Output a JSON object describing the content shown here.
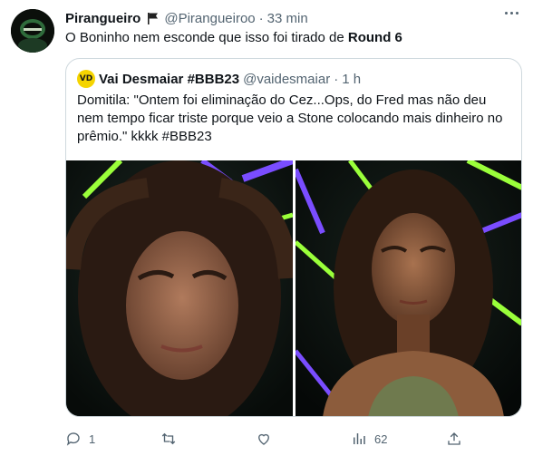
{
  "tweet": {
    "author_name": "Pirangueiro",
    "handle": "@Pirangueiroo",
    "separator": "·",
    "time": "33 min",
    "text_before": "O Boninho nem esconde que isso foi tirado de ",
    "text_bold": "Round 6",
    "icons": {
      "avatar": "squid-game-avatar",
      "flag": "flag-icon",
      "more": "more-icon"
    }
  },
  "quoted": {
    "author_name": "Vai Desmaiar #BBB23",
    "handle": "@vaidesmaiar",
    "separator": "·",
    "time": "1 h",
    "avatar_text": "VD",
    "text": "Domitila: \"Ontem foi eliminação do Cez...Ops, do Fred mas não deu nem tempo ficar triste porque veio a Stone colocando mais dinheiro no prêmio.\" kkkk #BBB23",
    "photos": [
      "photo-woman-left",
      "photo-woman-right"
    ]
  },
  "actions": {
    "reply_count": "1",
    "retweet_count": "",
    "like_count": "",
    "views_count": "62",
    "icons": [
      "reply-icon",
      "retweet-icon",
      "like-icon",
      "views-icon",
      "share-icon"
    ]
  },
  "colors": {
    "text": "#0f1419",
    "muted": "#536471",
    "border": "#cfd9de",
    "neon": "#9aff3a",
    "purple": "#7a4dff"
  }
}
